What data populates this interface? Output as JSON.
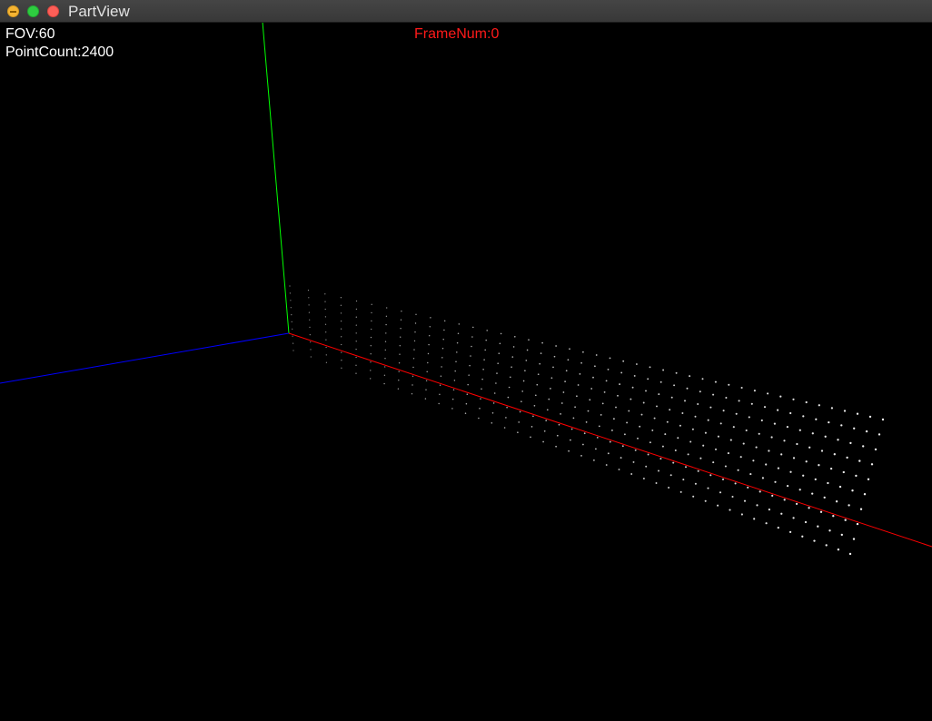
{
  "window": {
    "title": "PartView"
  },
  "hud": {
    "fov": "FOV:60",
    "point_count": "PointCount:2400",
    "frame_num": "FrameNum:0",
    "frame_color": "#ff1a1a"
  },
  "axes": {
    "x_color": "#ff0000",
    "y_color": "#00ff00",
    "z_color": "#0000ff"
  },
  "points": {
    "color": "#ffffff"
  }
}
